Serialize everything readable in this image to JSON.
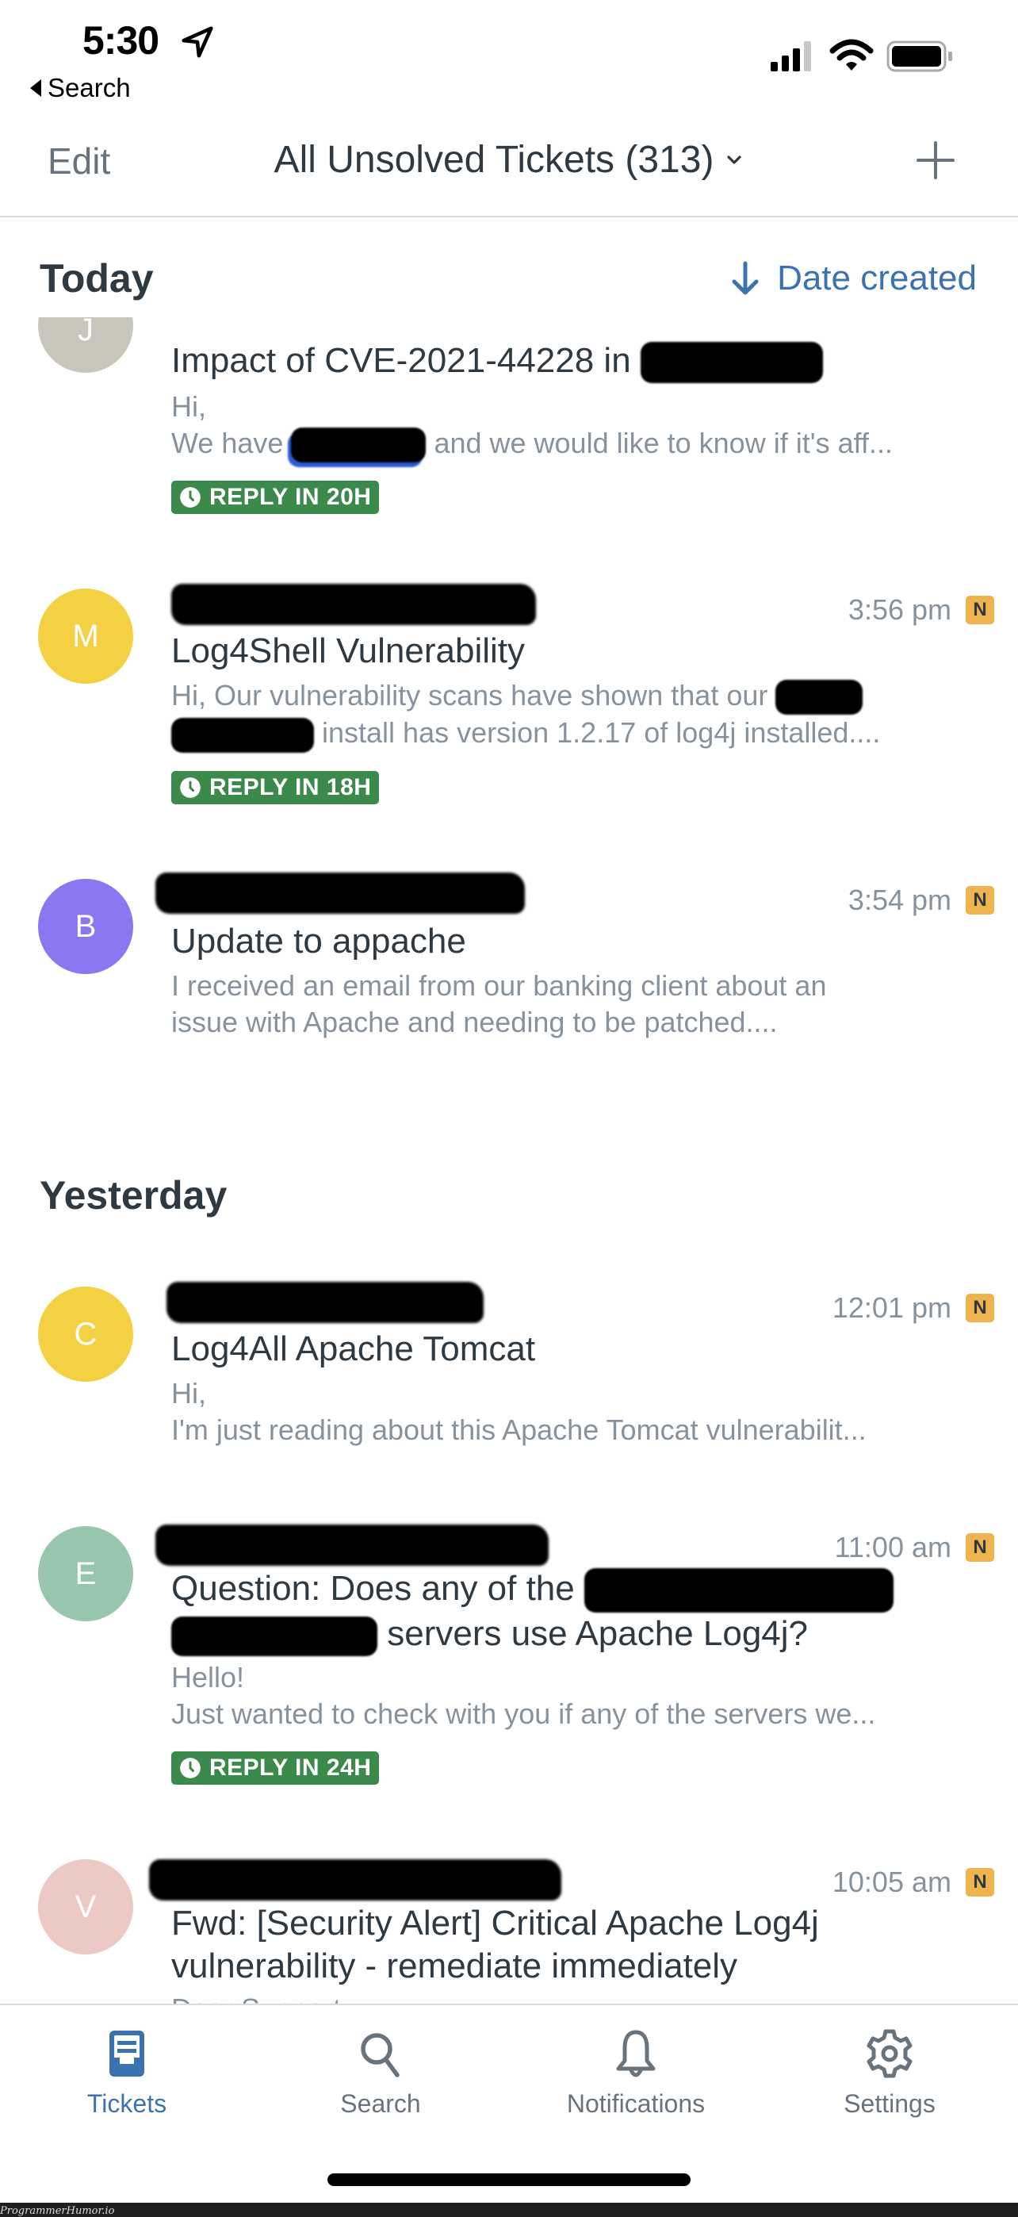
{
  "status_bar": {
    "time": "5:30",
    "back_label": "Search"
  },
  "nav": {
    "edit_label": "Edit",
    "view_title": "All Unsolved Tickets (313)"
  },
  "sort": {
    "label": "Date created",
    "direction": "descending"
  },
  "sections": [
    {
      "title": "Today",
      "tickets": [
        {
          "avatar_initial": "J",
          "avatar_color": "#c8c5bb",
          "subject": "Impact of CVE-2021-44228 in",
          "preview_line1": "Hi,",
          "preview_line2_before": "We have",
          "preview_line2_after": "and we would like to know if it's aff...",
          "reply_badge": "REPLY IN 20H"
        },
        {
          "avatar_initial": "M",
          "avatar_color": "#f3d143",
          "time": "3:56 pm",
          "status_badge": "N",
          "subject": "Log4Shell Vulnerability",
          "preview_line1": "Hi,  Our vulnerability scans have shown that our",
          "preview_line2": "install has version 1.2.17 of log4j installed....",
          "reply_badge": "REPLY IN 18H"
        },
        {
          "avatar_initial": "B",
          "avatar_color": "#8b78f0",
          "time": "3:54 pm",
          "status_badge": "N",
          "subject": "Update to appache",
          "preview_line1": "I received an email from our banking client about an",
          "preview_line2": "issue with Apache and needing to be patched...."
        }
      ]
    },
    {
      "title": "Yesterday",
      "tickets": [
        {
          "avatar_initial": "C",
          "avatar_color": "#f3d143",
          "time": "12:01 pm",
          "status_badge": "N",
          "subject": "Log4All Apache Tomcat",
          "preview_line1": "Hi,",
          "preview_line2": "I'm just reading about this Apache Tomcat vulnerabilit..."
        },
        {
          "avatar_initial": "E",
          "avatar_color": "#98c6ac",
          "time": "11:00 am",
          "status_badge": "N",
          "subject_line1": "Question: Does any of the",
          "subject_line2": "servers use Apache Log4j?",
          "preview_line1": "Hello!",
          "preview_line2": "Just wanted to check with you if any of the servers we...",
          "reply_badge": "REPLY IN 24H"
        },
        {
          "avatar_initial": "V",
          "avatar_color": "#ecc9c5",
          "time": "10:05 am",
          "status_badge": "N",
          "subject_line1": "Fwd: [Security Alert] Critical Apache Log4j",
          "subject_line2": "vulnerability - remediate immediately",
          "preview_line1": "Dear Support"
        }
      ]
    }
  ],
  "tab_bar": {
    "tabs": [
      {
        "label": "Tickets",
        "icon": "inbox-icon",
        "active": true
      },
      {
        "label": "Search",
        "icon": "search-icon",
        "active": false
      },
      {
        "label": "Notifications",
        "icon": "bell-icon",
        "active": false
      },
      {
        "label": "Settings",
        "icon": "gear-icon",
        "active": false
      }
    ]
  },
  "colors": {
    "accent_blue": "#3b73b0",
    "reply_green": "#3b8a4b",
    "new_badge": "#f0b44e",
    "text_primary": "#2f3941",
    "text_secondary": "#87929d"
  },
  "watermark": "ProgrammerHumor.io"
}
